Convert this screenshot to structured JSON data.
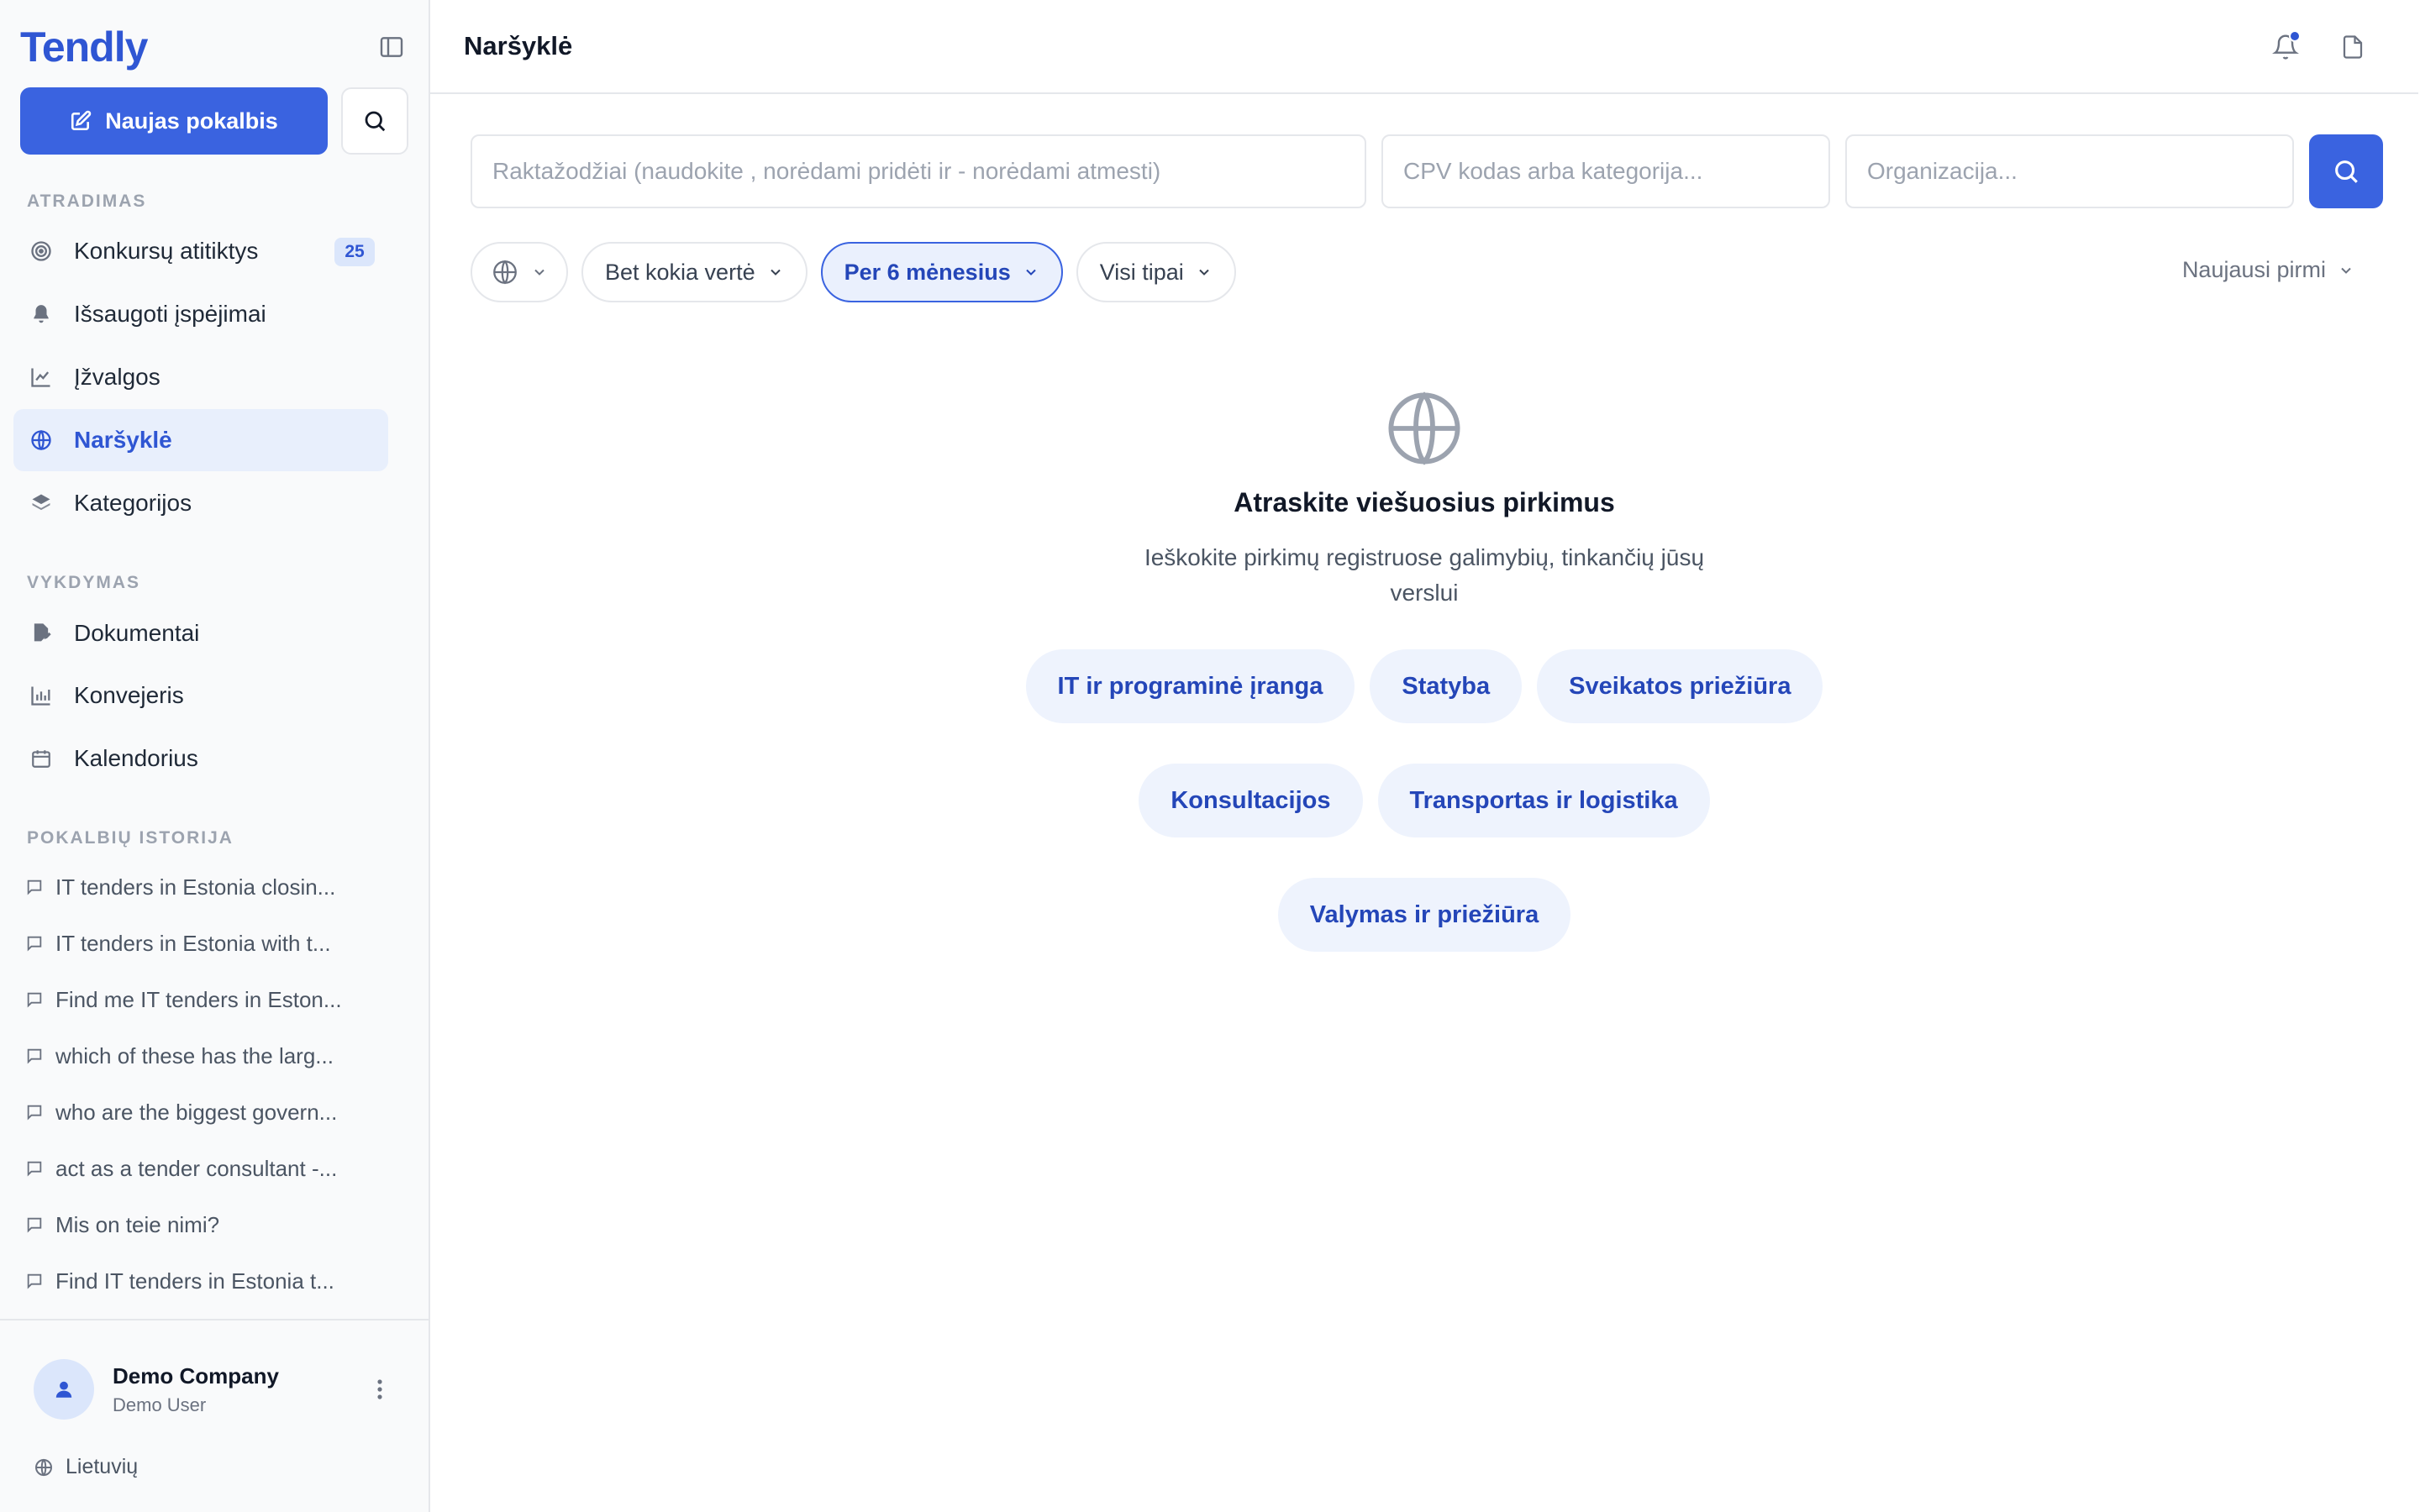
{
  "app": {
    "brand": "Tendly"
  },
  "sidebar": {
    "new_chat_label": "Naujas pokalbis",
    "sections": {
      "discovery": "ATRADIMAS",
      "execution": "VYKDYMAS",
      "history": "POKALBIŲ ISTORIJA"
    },
    "discovery_items": [
      {
        "label": "Konkursų atitiktys",
        "icon": "target-icon",
        "badge": "25"
      },
      {
        "label": "Išsaugoti įspėjimai",
        "icon": "bell-icon"
      },
      {
        "label": "Įžvalgos",
        "icon": "trend-chart-icon"
      },
      {
        "label": "Naršyklė",
        "icon": "globe-icon",
        "active": true
      },
      {
        "label": "Kategorijos",
        "icon": "layers-icon"
      }
    ],
    "execution_items": [
      {
        "label": "Dokumentai",
        "icon": "document-edit-icon"
      },
      {
        "label": "Konvejeris",
        "icon": "bar-chart-icon"
      },
      {
        "label": "Kalendorius",
        "icon": "calendar-icon"
      }
    ],
    "history_items": [
      "IT tenders in Estonia closin...",
      "IT tenders in Estonia with t...",
      "Find me IT tenders in Eston...",
      "which of these has the larg...",
      "who are the biggest govern...",
      "act as a tender consultant -...",
      "Mis on teie nimi?",
      "Find IT tenders in Estonia t..."
    ],
    "user": {
      "company": "Demo Company",
      "name": "Demo User"
    },
    "language": "Lietuvių"
  },
  "header": {
    "title": "Naršyklė"
  },
  "search": {
    "keywords_placeholder": "Raktažodžiai (naudokite , norėdami pridėti ir - norėdami atmesti)",
    "cpv_placeholder": "CPV kodas arba kategorija...",
    "org_placeholder": "Organizacija..."
  },
  "filters": {
    "value": "Bet kokia vertė",
    "period": "Per 6 mėnesius",
    "types": "Visi tipai",
    "sort": "Naujausi pirmi"
  },
  "empty_state": {
    "title": "Atraskite viešuosius pirkimus",
    "description": "Ieškokite pirkimų registruose galimybių, tinkančių jūsų verslui",
    "categories": [
      "IT ir programinė įranga",
      "Statyba",
      "Sveikatos priežiūra",
      "Konsultacijos",
      "Transportas ir logistika",
      "Valymas ir priežiūra"
    ]
  },
  "colors": {
    "accent": "#3a63e0",
    "brand": "#2f56d3",
    "active_bg": "#e8effc"
  }
}
